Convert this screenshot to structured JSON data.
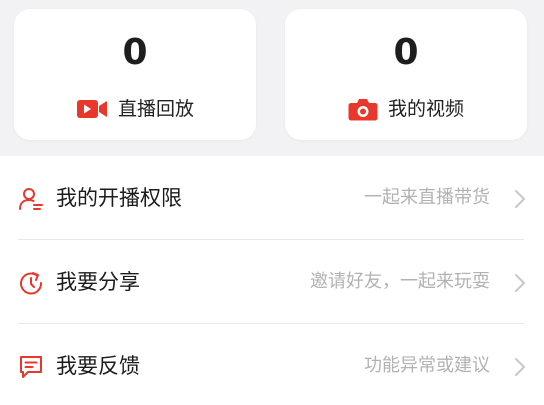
{
  "stats": [
    {
      "count": "0",
      "label": "直播回放",
      "icon": "video-camera-icon"
    },
    {
      "count": "0",
      "label": "我的视频",
      "icon": "camera-icon"
    }
  ],
  "menu": [
    {
      "label": "我的开播权限",
      "hint": "一起来直播带货",
      "icon": "user-permission-icon"
    },
    {
      "label": "我要分享",
      "hint": "邀请好友，一起来玩耍",
      "icon": "share-icon"
    },
    {
      "label": "我要反馈",
      "hint": "功能异常或建议",
      "icon": "feedback-icon"
    }
  ],
  "colors": {
    "accent": "#e8382c",
    "background": "#f2f2f4",
    "hint": "#b2b2b2",
    "text": "#1c1c1c"
  }
}
